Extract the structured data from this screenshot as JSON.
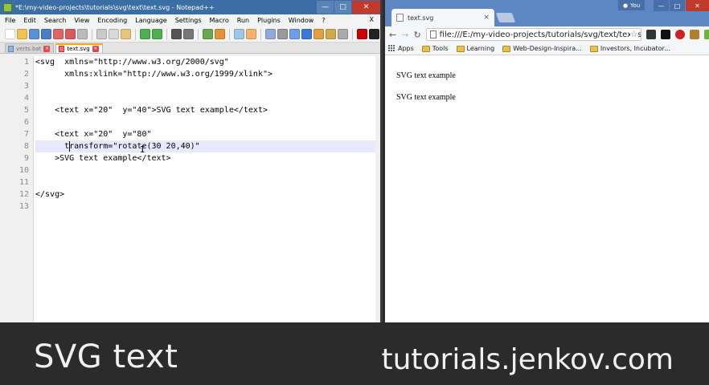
{
  "notepad": {
    "title": "*E:\\my-video-projects\\tutorials\\svg\\text\\text.svg - Notepad++",
    "menu": [
      "File",
      "Edit",
      "Search",
      "View",
      "Encoding",
      "Language",
      "Settings",
      "Macro",
      "Run",
      "Plugins",
      "Window",
      "?"
    ],
    "menu_close": "X",
    "tabs": [
      {
        "label": "verts.bat",
        "active": false
      },
      {
        "label": "text.svg",
        "active": true
      }
    ],
    "line_numbers": [
      "1",
      "2",
      "3",
      "4",
      "5",
      "6",
      "7",
      "8",
      "9",
      "10",
      "11",
      "12",
      "13"
    ],
    "lines": [
      "<svg  xmlns=\"http://www.w3.org/2000/svg\"",
      "      xmlns:xlink=\"http://www.w3.org/1999/xlink\">",
      "",
      "",
      "    <text x=\"20\"  y=\"40\">SVG text example</text>",
      "",
      "    <text x=\"20\"  y=\"80\"",
      "      transform=\"rotate(30 20,40)\"",
      "    >SVG text example</text>",
      "",
      "",
      "</svg>",
      ""
    ]
  },
  "chrome": {
    "tab_title": "text.svg",
    "tab_close": "×",
    "user": "You",
    "url": "file:///E:/my-video-projects/tutorials/svg/text/text.svg",
    "bookmarks": [
      "Apps",
      "Tools",
      "Learning",
      "Web-Design-Inspira...",
      "Investors, Incubator..."
    ],
    "content": [
      "SVG text example",
      "SVG text example"
    ]
  },
  "banner": {
    "left": "SVG text",
    "right": "tutorials.jenkov.com"
  },
  "colors": {
    "titlebar": "#3b6ea5",
    "chrome_tabbar": "#5c87c4",
    "banner_bg": "#2b2b2b",
    "current_line": "#e8e8ff"
  }
}
